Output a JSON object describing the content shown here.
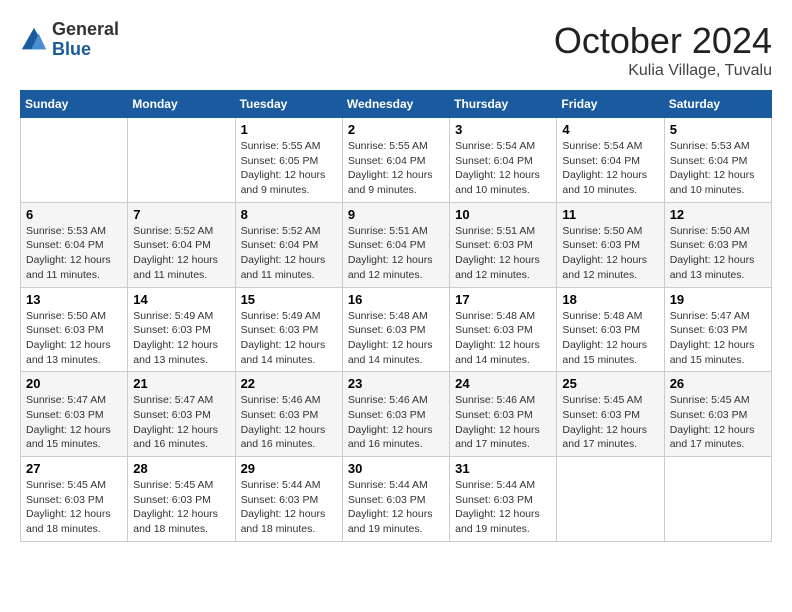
{
  "logo": {
    "general": "General",
    "blue": "Blue"
  },
  "title": "October 2024",
  "location": "Kulia Village, Tuvalu",
  "days_of_week": [
    "Sunday",
    "Monday",
    "Tuesday",
    "Wednesday",
    "Thursday",
    "Friday",
    "Saturday"
  ],
  "weeks": [
    [
      {
        "day": "",
        "details": ""
      },
      {
        "day": "",
        "details": ""
      },
      {
        "day": "1",
        "details": "Sunrise: 5:55 AM\nSunset: 6:05 PM\nDaylight: 12 hours and 9 minutes."
      },
      {
        "day": "2",
        "details": "Sunrise: 5:55 AM\nSunset: 6:04 PM\nDaylight: 12 hours and 9 minutes."
      },
      {
        "day": "3",
        "details": "Sunrise: 5:54 AM\nSunset: 6:04 PM\nDaylight: 12 hours and 10 minutes."
      },
      {
        "day": "4",
        "details": "Sunrise: 5:54 AM\nSunset: 6:04 PM\nDaylight: 12 hours and 10 minutes."
      },
      {
        "day": "5",
        "details": "Sunrise: 5:53 AM\nSunset: 6:04 PM\nDaylight: 12 hours and 10 minutes."
      }
    ],
    [
      {
        "day": "6",
        "details": "Sunrise: 5:53 AM\nSunset: 6:04 PM\nDaylight: 12 hours and 11 minutes."
      },
      {
        "day": "7",
        "details": "Sunrise: 5:52 AM\nSunset: 6:04 PM\nDaylight: 12 hours and 11 minutes."
      },
      {
        "day": "8",
        "details": "Sunrise: 5:52 AM\nSunset: 6:04 PM\nDaylight: 12 hours and 11 minutes."
      },
      {
        "day": "9",
        "details": "Sunrise: 5:51 AM\nSunset: 6:04 PM\nDaylight: 12 hours and 12 minutes."
      },
      {
        "day": "10",
        "details": "Sunrise: 5:51 AM\nSunset: 6:03 PM\nDaylight: 12 hours and 12 minutes."
      },
      {
        "day": "11",
        "details": "Sunrise: 5:50 AM\nSunset: 6:03 PM\nDaylight: 12 hours and 12 minutes."
      },
      {
        "day": "12",
        "details": "Sunrise: 5:50 AM\nSunset: 6:03 PM\nDaylight: 12 hours and 13 minutes."
      }
    ],
    [
      {
        "day": "13",
        "details": "Sunrise: 5:50 AM\nSunset: 6:03 PM\nDaylight: 12 hours and 13 minutes."
      },
      {
        "day": "14",
        "details": "Sunrise: 5:49 AM\nSunset: 6:03 PM\nDaylight: 12 hours and 13 minutes."
      },
      {
        "day": "15",
        "details": "Sunrise: 5:49 AM\nSunset: 6:03 PM\nDaylight: 12 hours and 14 minutes."
      },
      {
        "day": "16",
        "details": "Sunrise: 5:48 AM\nSunset: 6:03 PM\nDaylight: 12 hours and 14 minutes."
      },
      {
        "day": "17",
        "details": "Sunrise: 5:48 AM\nSunset: 6:03 PM\nDaylight: 12 hours and 14 minutes."
      },
      {
        "day": "18",
        "details": "Sunrise: 5:48 AM\nSunset: 6:03 PM\nDaylight: 12 hours and 15 minutes."
      },
      {
        "day": "19",
        "details": "Sunrise: 5:47 AM\nSunset: 6:03 PM\nDaylight: 12 hours and 15 minutes."
      }
    ],
    [
      {
        "day": "20",
        "details": "Sunrise: 5:47 AM\nSunset: 6:03 PM\nDaylight: 12 hours and 15 minutes."
      },
      {
        "day": "21",
        "details": "Sunrise: 5:47 AM\nSunset: 6:03 PM\nDaylight: 12 hours and 16 minutes."
      },
      {
        "day": "22",
        "details": "Sunrise: 5:46 AM\nSunset: 6:03 PM\nDaylight: 12 hours and 16 minutes."
      },
      {
        "day": "23",
        "details": "Sunrise: 5:46 AM\nSunset: 6:03 PM\nDaylight: 12 hours and 16 minutes."
      },
      {
        "day": "24",
        "details": "Sunrise: 5:46 AM\nSunset: 6:03 PM\nDaylight: 12 hours and 17 minutes."
      },
      {
        "day": "25",
        "details": "Sunrise: 5:45 AM\nSunset: 6:03 PM\nDaylight: 12 hours and 17 minutes."
      },
      {
        "day": "26",
        "details": "Sunrise: 5:45 AM\nSunset: 6:03 PM\nDaylight: 12 hours and 17 minutes."
      }
    ],
    [
      {
        "day": "27",
        "details": "Sunrise: 5:45 AM\nSunset: 6:03 PM\nDaylight: 12 hours and 18 minutes."
      },
      {
        "day": "28",
        "details": "Sunrise: 5:45 AM\nSunset: 6:03 PM\nDaylight: 12 hours and 18 minutes."
      },
      {
        "day": "29",
        "details": "Sunrise: 5:44 AM\nSunset: 6:03 PM\nDaylight: 12 hours and 18 minutes."
      },
      {
        "day": "30",
        "details": "Sunrise: 5:44 AM\nSunset: 6:03 PM\nDaylight: 12 hours and 19 minutes."
      },
      {
        "day": "31",
        "details": "Sunrise: 5:44 AM\nSunset: 6:03 PM\nDaylight: 12 hours and 19 minutes."
      },
      {
        "day": "",
        "details": ""
      },
      {
        "day": "",
        "details": ""
      }
    ]
  ]
}
